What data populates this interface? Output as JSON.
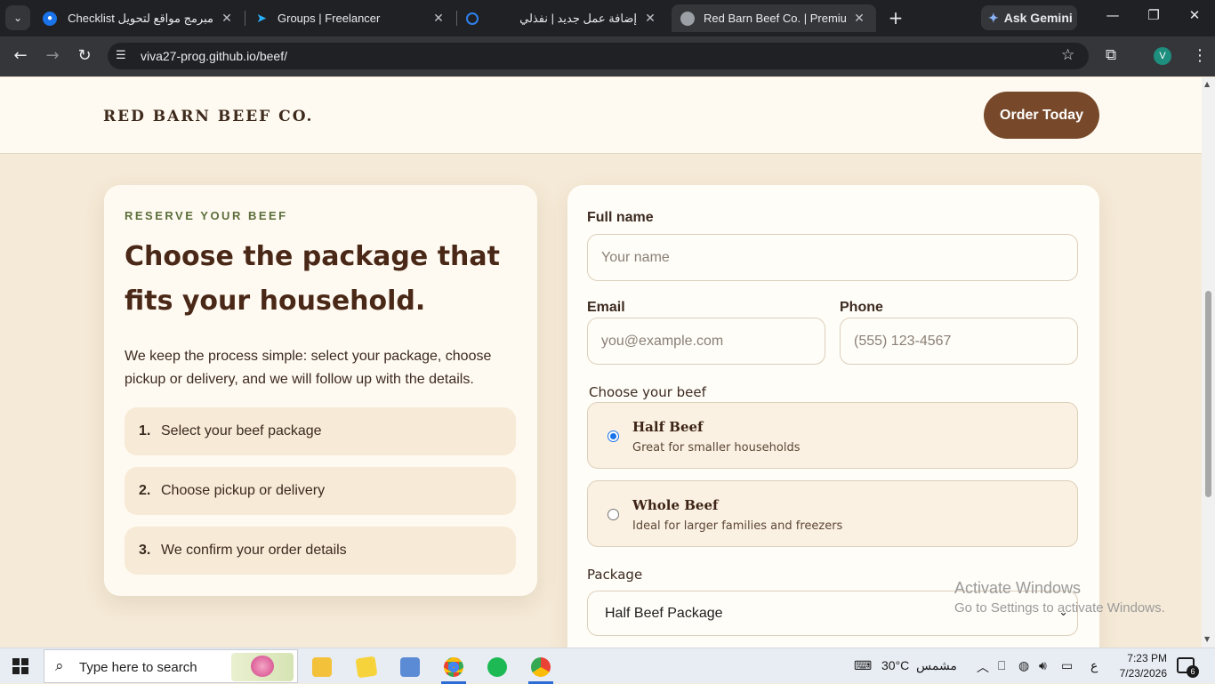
{
  "browser": {
    "tabs": [
      {
        "title": "مبرمج مواقع لتحويل Checklist إلى"
      },
      {
        "title": "Groups | Freelancer"
      },
      {
        "title": "إضافة عمل جديد | نفذلي"
      },
      {
        "title": "Red Barn Beef Co. | Premium Fa"
      }
    ],
    "new_tab": "+",
    "ask_gemini": "Ask Gemini",
    "url": "viva27-prog.github.io/beef/",
    "profile_initial": "V",
    "window_controls": {
      "minimize": "—",
      "restore": "❐",
      "close": "✕"
    }
  },
  "site": {
    "brand": "RED BARN BEEF CO.",
    "order_button": "Order Today"
  },
  "intro_card": {
    "eyebrow": "RESERVE YOUR BEEF",
    "headline": "Choose the package that fits your household.",
    "description": "We keep the process simple: select your package, choose pickup or delivery, and we will follow up with the details.",
    "steps": [
      {
        "num": "1.",
        "text": "Select your beef package"
      },
      {
        "num": "2.",
        "text": "Choose pickup or delivery"
      },
      {
        "num": "3.",
        "text": "We confirm your order details"
      }
    ]
  },
  "form": {
    "full_name": {
      "label": "Full name",
      "placeholder": "Your name"
    },
    "email": {
      "label": "Email",
      "placeholder": "you@example.com"
    },
    "phone": {
      "label": "Phone",
      "placeholder": "(555) 123-4567"
    },
    "beef_label": "Choose your beef",
    "beef_options": [
      {
        "title": "Half Beef",
        "subtitle": "Great for smaller households",
        "selected": true
      },
      {
        "title": "Whole Beef",
        "subtitle": "Ideal for larger families and freezers",
        "selected": false
      }
    ],
    "package": {
      "label": "Package",
      "selected": "Half Beef Package"
    }
  },
  "watermark": {
    "line1": "Activate Windows",
    "line2": "Go to Settings to activate Windows."
  },
  "taskbar": {
    "search_placeholder": "Type here to search",
    "weather": "30°C",
    "weather_text": "مشمس",
    "lang": "ع",
    "time": "7:23 PM",
    "date": "7/23/2026",
    "notifications": "6"
  },
  "colors": {
    "accent_brown": "#77492a",
    "page_bg": "#f5ead7",
    "eyebrow_green": "#5b6e3b",
    "radio_blue": "#1a73e8"
  }
}
